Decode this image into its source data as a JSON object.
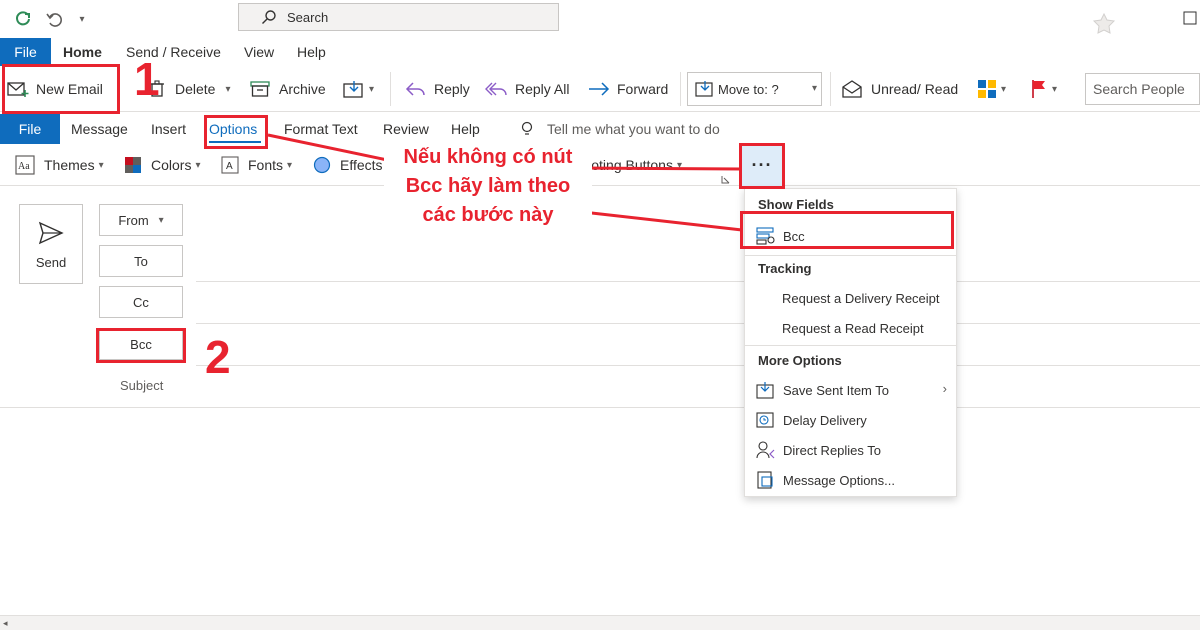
{
  "titlebar": {
    "search_label": "Search"
  },
  "main_tabs": [
    "File",
    "Home",
    "Send / Receive",
    "View",
    "Help"
  ],
  "home_ribbon": {
    "new_email": "New Email",
    "delete": "Delete",
    "archive": "Archive",
    "reply": "Reply",
    "reply_all": "Reply All",
    "forward": "Forward",
    "move_to": "Move to: ?",
    "unread_read": "Unread/ Read",
    "search_people": "Search People"
  },
  "compose_tabs": [
    "File",
    "Message",
    "Insert",
    "Options",
    "Format Text",
    "Review",
    "Help"
  ],
  "tell_me": "Tell me what you want to do",
  "options_ribbon": {
    "themes": "Themes",
    "colors": "Colors",
    "fonts": "Fonts",
    "effects": "Effects",
    "voting": "e Voting Buttons",
    "more": "···"
  },
  "compose": {
    "send": "Send",
    "from": "From",
    "from_value": "",
    "to": "To",
    "cc": "Cc",
    "bcc": "Bcc",
    "subject": "Subject"
  },
  "dropdown": {
    "show_fields_header": "Show Fields",
    "bcc": "Bcc",
    "tracking_header": "Tracking",
    "delivery_receipt": "Request a Delivery Receipt",
    "read_receipt": "Request a Read Receipt",
    "more_options_header": "More Options",
    "save_sent_item": "Save Sent Item To",
    "delay_delivery": "Delay Delivery",
    "direct_replies": "Direct Replies To",
    "message_options": "Message Options..."
  },
  "annotations": {
    "step1": "1",
    "step2": "2",
    "callout_line1": "Nếu không có nút",
    "callout_line2": "Bcc hãy làm theo",
    "callout_line3": "các bước này"
  },
  "colors": {
    "accent": "#0f6cbd",
    "annotation_red": "#e8232f"
  }
}
